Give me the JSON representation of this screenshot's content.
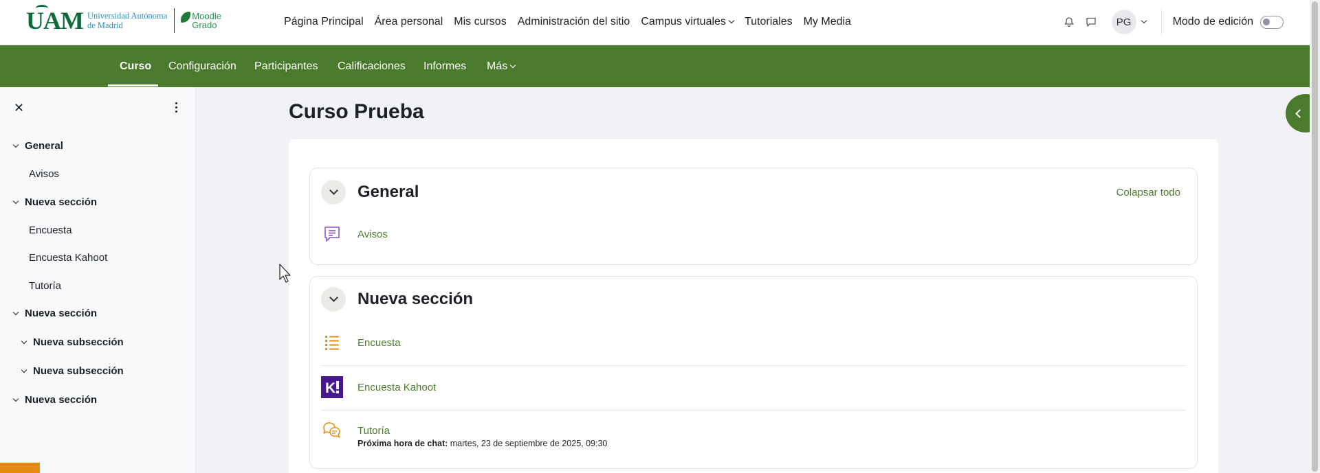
{
  "brand": {
    "university_line1": "Universidad Autónoma",
    "university_line2": "de Madrid",
    "logo_mark": "UAM",
    "moodle_line1": "Moodle",
    "moodle_line2": "Grado"
  },
  "mainnav": {
    "items": [
      "Página Principal",
      "Área personal",
      "Mis cursos",
      "Administración del sitio",
      "Campus virtuales",
      "Tutoriales",
      "My Media"
    ]
  },
  "usermenu": {
    "initials": "PG",
    "edit_mode_label": "Modo de edición",
    "edit_mode_on": false
  },
  "secondary_nav": {
    "tabs": [
      "Curso",
      "Configuración",
      "Participantes",
      "Calificaciones",
      "Informes",
      "Más"
    ],
    "active": "Curso"
  },
  "course_index": {
    "items": [
      {
        "label": "General",
        "type": "section"
      },
      {
        "label": "Avisos",
        "type": "activity"
      },
      {
        "label": "Nueva sección",
        "type": "section"
      },
      {
        "label": "Encuesta",
        "type": "activity"
      },
      {
        "label": "Encuesta Kahoot",
        "type": "activity"
      },
      {
        "label": "Tutoría",
        "type": "activity"
      },
      {
        "label": "Nueva sección",
        "type": "section"
      },
      {
        "label": "Nueva subsección",
        "type": "subsection"
      },
      {
        "label": "Nueva subsección",
        "type": "subsection"
      },
      {
        "label": "Nueva sección",
        "type": "section"
      }
    ]
  },
  "course": {
    "title": "Curso Prueba",
    "collapse_all": "Colapsar todo",
    "sections": [
      {
        "title": "General",
        "activities": [
          {
            "name": "Avisos",
            "icon": "forum-icon"
          }
        ]
      },
      {
        "title": "Nueva sección",
        "activities": [
          {
            "name": "Encuesta",
            "icon": "choice-icon"
          },
          {
            "name": "Encuesta Kahoot",
            "icon": "kahoot-icon"
          },
          {
            "name": "Tutoría",
            "icon": "chat-icon",
            "info_label": "Próxima hora de chat:",
            "info_value": " martes, 23 de septiembre de 2025, 09:30"
          }
        ]
      }
    ]
  },
  "colors": {
    "brand_green": "#4a7b2c",
    "activity_purple": "#8a4fcf",
    "activity_orange": "#e6890f",
    "kahoot_purple": "#46178f"
  }
}
